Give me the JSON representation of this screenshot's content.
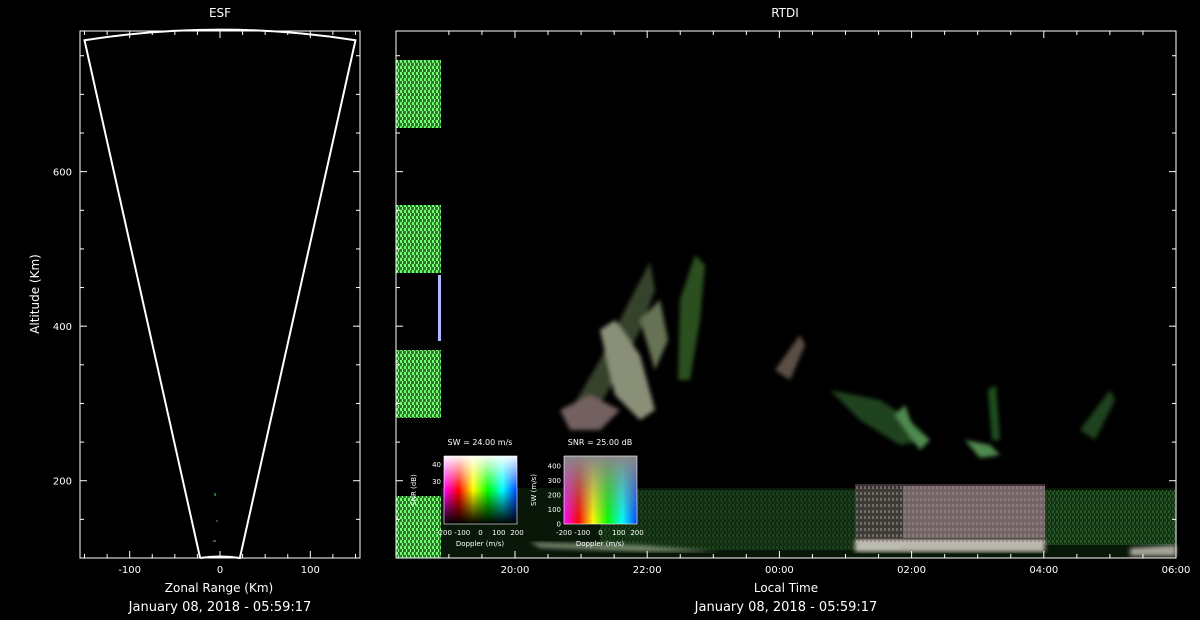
{
  "chart_data": [
    {
      "type": "scatter",
      "title": "ESF",
      "xlabel": "Zonal Range (Km)",
      "ylabel": "Altitude (Km)",
      "xlim": [
        -155,
        155
      ],
      "ylim": [
        100,
        782
      ],
      "x_ticks": [
        -100,
        0,
        100
      ],
      "x_tick_labels": [
        "-100",
        "0",
        "100"
      ],
      "y_ticks": [
        200,
        400,
        600
      ],
      "y_tick_labels": [
        "200",
        "400",
        "600"
      ],
      "fan_outline": {
        "min_altitude": 100,
        "max_altitude": 782,
        "near_half_width": 22,
        "far_half_width": 150
      },
      "footer": "January 08, 2018 - 05:59:17",
      "grid": false
    },
    {
      "type": "heatmap",
      "title": "RTDI",
      "xlabel": "Local Time",
      "x_tick_labels": [
        "20:00",
        "22:00",
        "00:00",
        "02:00",
        "04:00",
        "06:00"
      ],
      "x_ticks_hours": [
        20,
        22,
        24,
        26,
        28,
        30
      ],
      "xlim_hours": [
        18.2,
        30
      ],
      "ylim": [
        100,
        782
      ],
      "footer": "January 08, 2018 - 05:59:17",
      "grid": false,
      "legends": [
        {
          "title": "SW = 24.00 m/s",
          "xlabel": "Doppler (m/s)",
          "ylabel": "SNR (dB)",
          "x_tick_labels": [
            "-200",
            "-100",
            "0",
            "100",
            "200"
          ],
          "y_tick_labels": [
            "30",
            "40"
          ]
        },
        {
          "title": "SNR = 25.00 dB",
          "xlabel": "Doppler (m/s)",
          "ylabel": "SW (m/s)",
          "x_tick_labels": [
            "-200",
            "-100",
            "0",
            "100",
            "200"
          ],
          "y_tick_labels": [
            "0",
            "100",
            "200",
            "300",
            "400"
          ]
        }
      ]
    }
  ],
  "colors": {
    "background": "#000000",
    "axes": "#ffffff",
    "echo_green": "#4cff4c",
    "echo_white": "#e8e0d8"
  }
}
